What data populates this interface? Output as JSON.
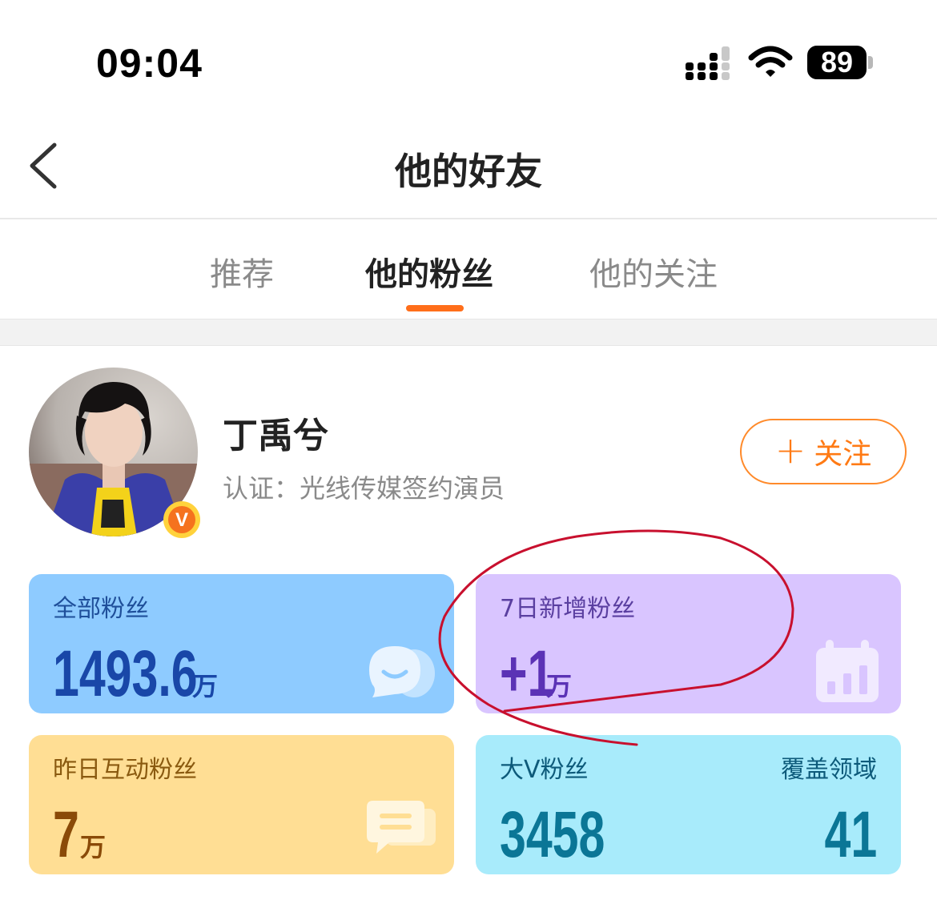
{
  "status_bar": {
    "time": "09:04",
    "battery": "89"
  },
  "nav": {
    "title": "他的好友"
  },
  "tabs": [
    {
      "label": "推荐",
      "active": false
    },
    {
      "label": "他的粉丝",
      "active": true
    },
    {
      "label": "他的关注",
      "active": false
    }
  ],
  "profile": {
    "name": "丁禹兮",
    "certification": "认证：光线传媒签约演员",
    "follow_label": "关注",
    "badge_letter": "V"
  },
  "stats": {
    "all_fans": {
      "label": "全部粉丝",
      "value": "1493.6",
      "unit": "万"
    },
    "new_fans_7d": {
      "label": "7日新增粉丝",
      "value": "+1",
      "unit": "万"
    },
    "interactive_fans_yesterday": {
      "label": "昨日互动粉丝",
      "value": "7",
      "unit": "万"
    },
    "big_v_fans": {
      "label": "大V粉丝",
      "value": "3458"
    },
    "coverage_domains": {
      "label": "覆盖领域",
      "value": "41"
    }
  },
  "colors": {
    "accent_orange": "#ff6e1a",
    "card_blue": "#8ecbff",
    "card_purple": "#d9c5ff",
    "card_yellow": "#ffde94",
    "card_cyan": "#a8ebfb",
    "annotation_red": "#c8102e"
  },
  "icons": [
    "signal-icon",
    "wifi-icon",
    "back-chevron-icon",
    "verified-v-icon",
    "plus-icon",
    "chat-bubbles-icon",
    "calendar-chart-icon",
    "message-icon"
  ]
}
